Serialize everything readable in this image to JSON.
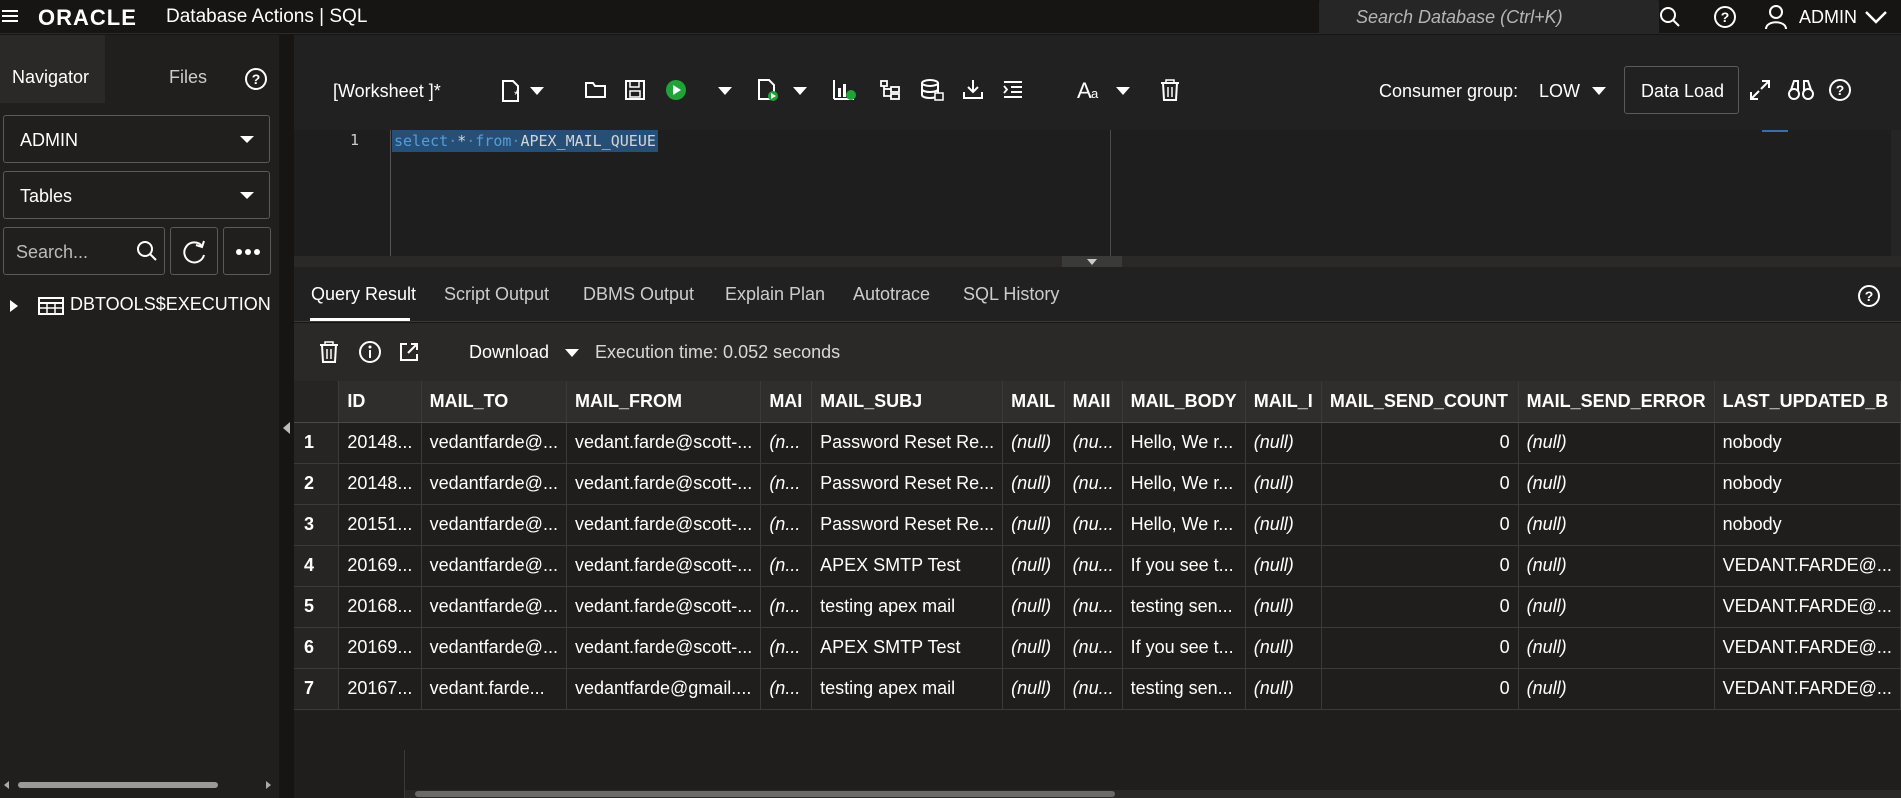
{
  "header": {
    "brand": "ORACLE",
    "app_title": "Database Actions | SQL",
    "search_placeholder": "Search Database (Ctrl+K)",
    "user": "ADMIN"
  },
  "left_panel": {
    "tabs": [
      "Navigator",
      "Files"
    ],
    "schema_select": "ADMIN",
    "object_type_select": "Tables",
    "search_placeholder": "Search...",
    "tree_items": [
      "DBTOOLS$EXECUTION_HISTORY"
    ]
  },
  "toolbar": {
    "worksheet_label": "[Worksheet ]*",
    "consumer_group_label": "Consumer group:",
    "consumer_group_value": "LOW",
    "data_load_label": "Data Load"
  },
  "editor": {
    "line_number": "1",
    "code_tokens": [
      "select",
      "*",
      "from",
      "APEX_MAIL_QUEUE"
    ]
  },
  "result_tabs": [
    "Query Result",
    "Script Output",
    "DBMS Output",
    "Explain Plan",
    "Autotrace",
    "SQL History"
  ],
  "result_toolbar": {
    "download_label": "Download",
    "execution_time": "Execution time: 0.052 seconds"
  },
  "grid": {
    "columns": [
      "ID",
      "MAIL_TO",
      "MAIL_FROM",
      "MAI",
      "MAIL_SUBJ",
      "MAIL",
      "MAII",
      "MAIL_BODY",
      "MAIL_I",
      "MAIL_SEND_COUNT",
      "MAIL_SEND_ERROR",
      "LAST_UPDATED_B"
    ],
    "rows": [
      [
        "1",
        "20148...",
        "vedantfarde@...",
        "vedant.farde@scott-...",
        "(n...",
        "Password Reset Re...",
        "(null)",
        "(nu...",
        "Hello, We r...",
        "(null)",
        "0",
        "(null)",
        "nobody"
      ],
      [
        "2",
        "20148...",
        "vedantfarde@...",
        "vedant.farde@scott-...",
        "(n...",
        "Password Reset Re...",
        "(null)",
        "(nu...",
        "Hello, We r...",
        "(null)",
        "0",
        "(null)",
        "nobody"
      ],
      [
        "3",
        "20151...",
        "vedantfarde@...",
        "vedant.farde@scott-...",
        "(n...",
        "Password Reset Re...",
        "(null)",
        "(nu...",
        "Hello, We r...",
        "(null)",
        "0",
        "(null)",
        "nobody"
      ],
      [
        "4",
        "20169...",
        "vedantfarde@...",
        "vedant.farde@scott-...",
        "(n...",
        "APEX SMTP Test",
        "(null)",
        "(nu...",
        "If you see t...",
        "(null)",
        "0",
        "(null)",
        "VEDANT.FARDE@..."
      ],
      [
        "5",
        "20168...",
        "vedantfarde@...",
        "vedant.farde@scott-...",
        "(n...",
        "testing apex mail",
        "(null)",
        "(nu...",
        "testing sen...",
        "(null)",
        "0",
        "(null)",
        "VEDANT.FARDE@..."
      ],
      [
        "6",
        "20169...",
        "vedantfarde@...",
        "vedant.farde@scott-...",
        "(n...",
        "APEX SMTP Test",
        "(null)",
        "(nu...",
        "If you see t...",
        "(null)",
        "0",
        "(null)",
        "VEDANT.FARDE@..."
      ],
      [
        "7",
        "20167...",
        "vedant.farde...",
        "vedantfarde@gmail....",
        "(n...",
        "testing apex mail",
        "(null)",
        "(nu...",
        "testing sen...",
        "(null)",
        "0",
        "(null)",
        "VEDANT.FARDE@..."
      ]
    ]
  }
}
